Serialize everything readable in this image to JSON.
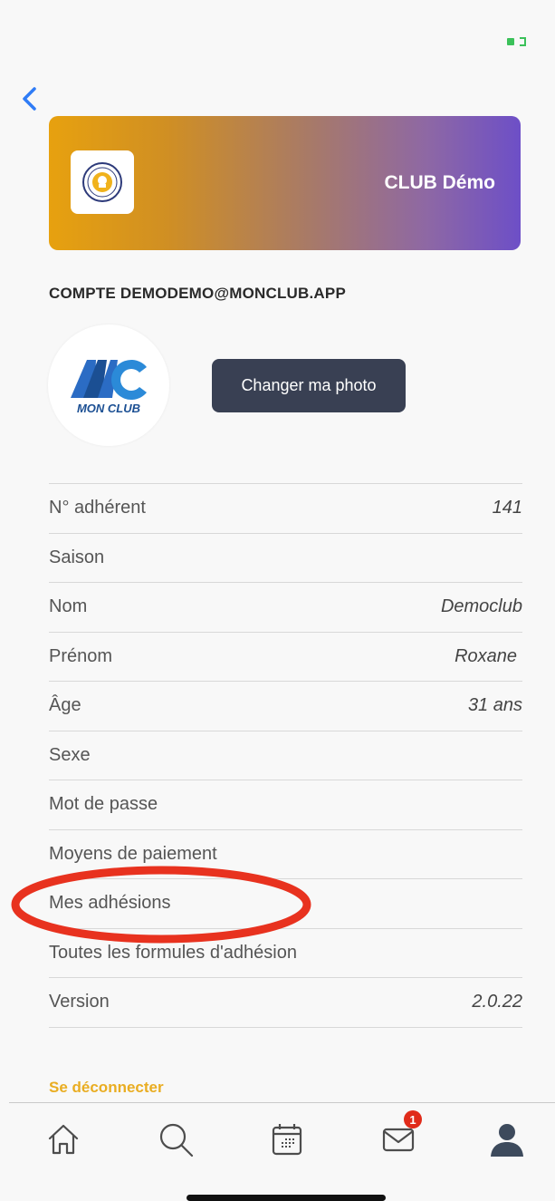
{
  "club": {
    "name": "CLUB Démo"
  },
  "account": {
    "title": "COMPTE DEMODEMO@MONCLUB.APP",
    "avatar_text": "MON CLUB",
    "change_photo_label": "Changer ma photo"
  },
  "rows": [
    {
      "label": "N° adhérent",
      "value": "141"
    },
    {
      "label": "Saison",
      "value": ""
    },
    {
      "label": "Nom",
      "value": "Democlub"
    },
    {
      "label": "Prénom",
      "value": "Roxane"
    },
    {
      "label": "Âge",
      "value": "31 ans"
    },
    {
      "label": "Sexe",
      "value": ""
    },
    {
      "label": "Mot de passe",
      "value": ""
    },
    {
      "label": "Moyens de paiement",
      "value": ""
    },
    {
      "label": "Mes adhésions",
      "value": ""
    },
    {
      "label": "Toutes les formules d'adhésion",
      "value": ""
    },
    {
      "label": "Version",
      "value": "2.0.22"
    }
  ],
  "logout_label": "Se déconnecter",
  "tabs": {
    "messages_badge": "1"
  },
  "colors": {
    "accent": "#e9ad22",
    "button": "#394053",
    "highlight": "#e8321f",
    "back": "#2f7cf6"
  },
  "icons": [
    "back-chevron",
    "home",
    "search",
    "calendar",
    "mail",
    "user",
    "battery"
  ]
}
